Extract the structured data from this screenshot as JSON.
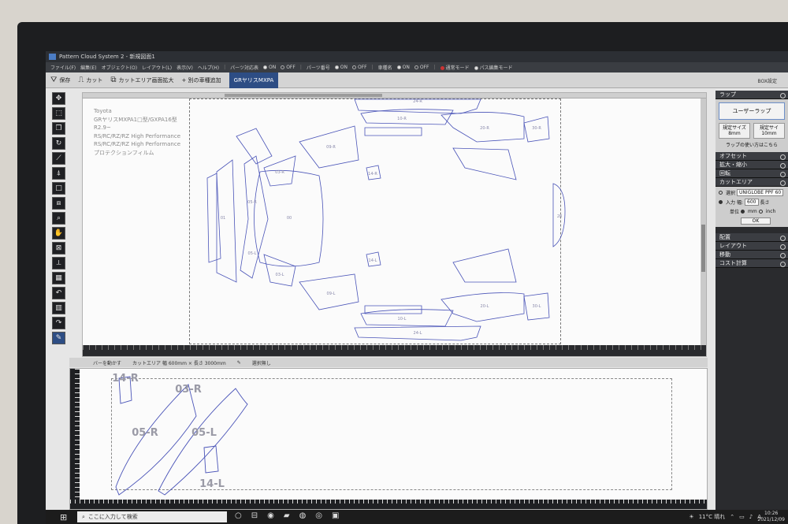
{
  "window": {
    "title": "Pattern Cloud System 2 - 新規図面1"
  },
  "menu": {
    "items": [
      "ファイル(F)",
      "編集(E)",
      "オブジェクト(O)",
      "レイアウト(L)",
      "表示(V)",
      "ヘルプ(H)"
    ],
    "parts_table": {
      "label": "パーツ対応表",
      "on": "ON",
      "off": "OFF"
    },
    "parts_number": {
      "label": "パーツ番号",
      "on": "ON",
      "off": "OFF"
    },
    "car_name": {
      "label": "車種名",
      "on": "ON",
      "off": "OFF"
    },
    "normal_mode": "通常モード",
    "path_edit_mode": "パス編集モード"
  },
  "toolbar": {
    "save": "保存",
    "cut": "カット",
    "cut_area_zoom": "カットエリア画面拡大",
    "add_other_car": "+ 別の車種追加",
    "active_tab": "GRヤリスMXPA",
    "box_settings": "BOX設定"
  },
  "car_info": [
    "Toyota",
    "GRヤリスMXPA1□型/GXPA16型",
    "R2.9~",
    "RS/RC/RZ/RZ High Performance",
    "RS/RC/RZ/RZ High Performance",
    "プロテクションフィルム"
  ],
  "part_labels_top": [
    "24-R",
    "10-R",
    "20-R",
    "09-R",
    "30-R",
    "14-R",
    "03-R",
    "05-R",
    "01",
    "00",
    "28",
    "05-L",
    "03-L",
    "09-L",
    "14-L",
    "20-L",
    "30-L",
    "10-L",
    "24-L"
  ],
  "statusbar": {
    "move_bar": "バーを動かす",
    "cut_area_size": "カットエリア 幅 600mm × 長さ 3000mm",
    "selection": "選択無し"
  },
  "part_labels_bottom": [
    "14-R",
    "03-R",
    "05-R",
    "05-L",
    "14-L"
  ],
  "right_panel": {
    "wrap": "ラップ",
    "user_wrap": "ユーザーラップ",
    "preset_size_1": "規定サイズ",
    "preset_size_1_value": "8mm",
    "preset_size_2": "規定サイ",
    "preset_size_2_value": "10mm",
    "wrap_help": "ラップの使い方はこちら",
    "offset": "オフセット",
    "scale": "拡大・縮小",
    "rotate": "回転",
    "cut_area": "カットエリア",
    "select_label": "選択",
    "select_value": "UNIGLOBE PPF 60",
    "input_label": "入力",
    "width_label": "幅:",
    "width_value": "600",
    "length_label": "長さ",
    "unit_label": "単位",
    "unit_mm": "mm",
    "unit_inch": "inch",
    "ok": "OK",
    "layout_place": "配置",
    "layout": "レイアウト",
    "move": "移動",
    "cost": "コスト計算"
  },
  "taskbar": {
    "search_placeholder": "ここに入力して検索",
    "weather": "11°C 晴れ",
    "ime": "A",
    "time": "10:26",
    "date": "2021/12/09"
  }
}
